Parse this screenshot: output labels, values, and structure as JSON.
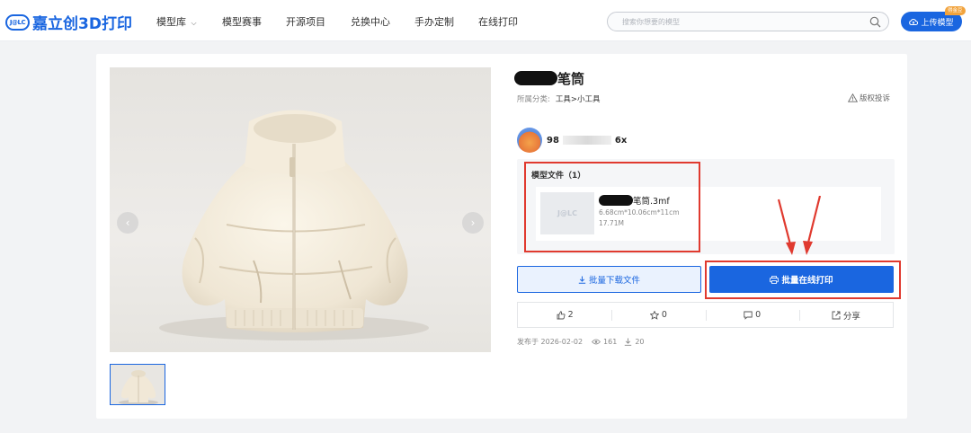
{
  "header": {
    "logo_badge": "J@LC",
    "logo_text": "嘉立创3D打印",
    "nav": [
      "模型库",
      "模型赛事",
      "开源项目",
      "兑换中心",
      "手办定制",
      "在线打印"
    ],
    "search_placeholder": "搜索你想要的模型",
    "upload_label": "上传模型",
    "upload_tag": "得金豆"
  },
  "model": {
    "title": "笔筒",
    "category_label": "所属分类:",
    "category_value": "工具>小工具",
    "report_label": "版权投诉",
    "author_prefix": "98",
    "author_suffix": "6x",
    "files_title": "模型文件（1）",
    "file_name": "笔筒.3mf",
    "file_dims": "6.68cm*10.06cm*11cm",
    "file_size": "17.71M",
    "download_label": "批量下载文件",
    "print_label": "批量在线打印",
    "likes": "2",
    "stars": "0",
    "comments": "0",
    "share_label": "分享",
    "published": "发布于 2026-02-02",
    "views": "161",
    "downloads": "20"
  },
  "colors": {
    "accent": "#1a66e0",
    "annotation": "#e03a2f"
  }
}
